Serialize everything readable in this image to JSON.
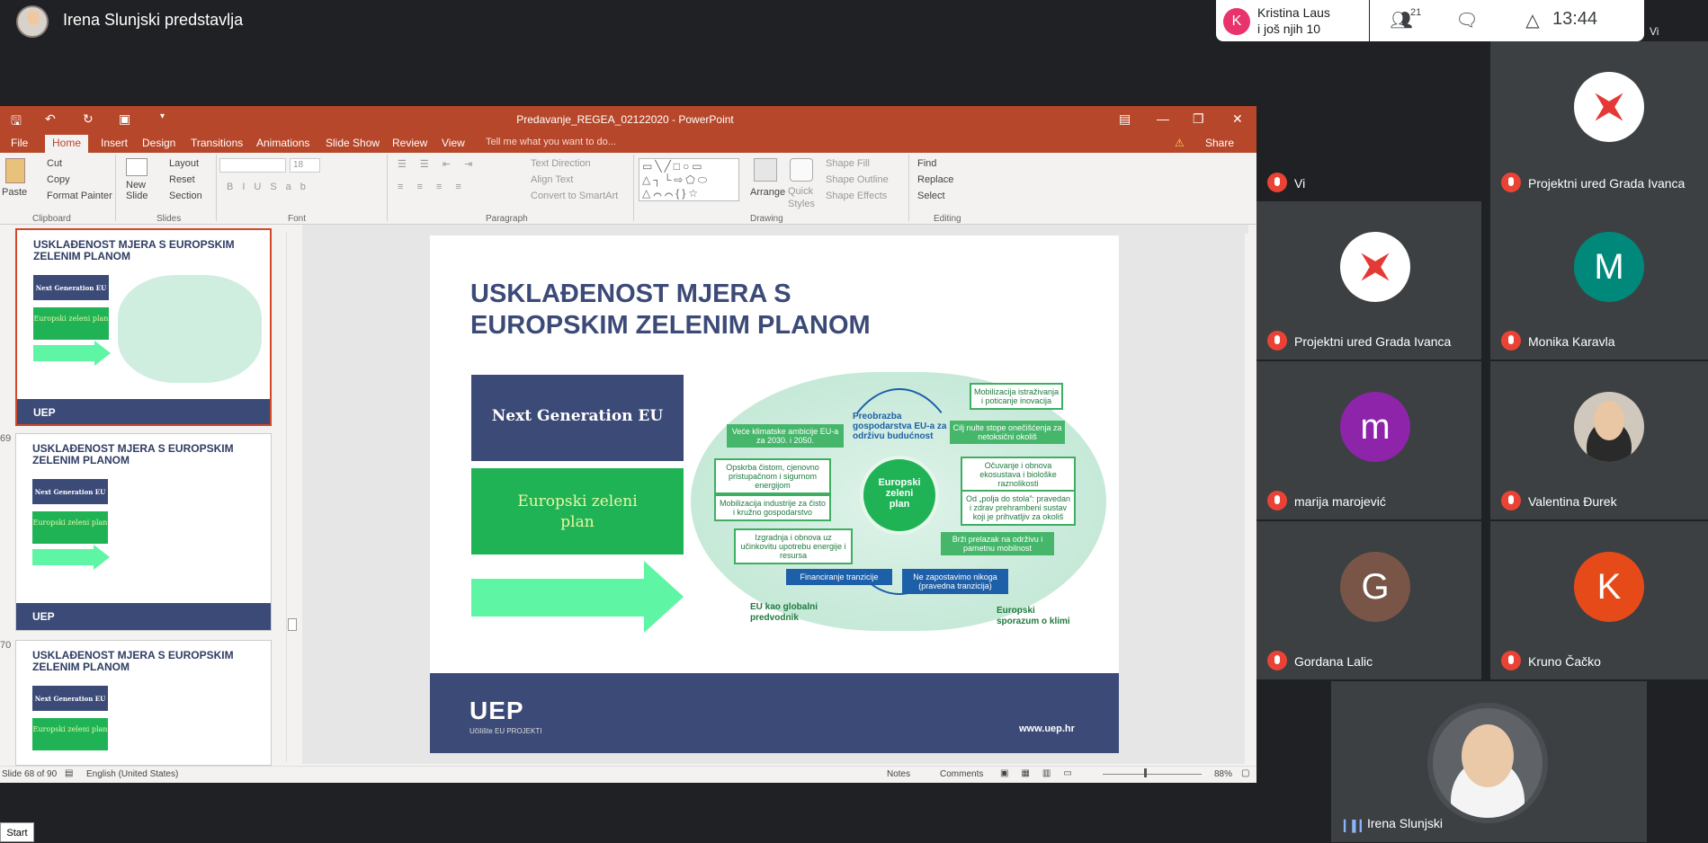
{
  "meet": {
    "presenting_title": "Irena Slunjski predstavlja",
    "notification": {
      "initial": "K",
      "name": "Kristina Laus",
      "more": "i još njih 10"
    },
    "people_count": "21",
    "clock": "13:44",
    "corner_label": "Vi"
  },
  "ppt": {
    "window_title": "Predavanje_REGEA_02122020 - PowerPoint",
    "tabs": [
      "File",
      "Home",
      "Insert",
      "Design",
      "Transitions",
      "Animations",
      "Slide Show",
      "Review",
      "View"
    ],
    "tell_me": "Tell me what you want to do...",
    "share": "Share",
    "ribbon": {
      "paste": "Paste",
      "cut": "Cut",
      "copy": "Copy",
      "format_painter": "Format Painter",
      "clipboard": "Clipboard",
      "new_slide": "New Slide",
      "layout": "Layout",
      "reset": "Reset",
      "section": "Section",
      "slides": "Slides",
      "font_size": "18",
      "font": "Font",
      "text_direction": "Text Direction",
      "align_text": "Align Text",
      "convert_smartart": "Convert to SmartArt",
      "paragraph": "Paragraph",
      "arrange": "Arrange",
      "quick_styles": "Quick Styles",
      "shape_fill": "Shape Fill",
      "shape_outline": "Shape Outline",
      "shape_effects": "Shape Effects",
      "drawing": "Drawing",
      "find": "Find",
      "replace": "Replace",
      "select": "Select",
      "editing": "Editing"
    },
    "thumbnails": [
      {
        "num": "",
        "title": "USKLAĐENOST MJERA S EUROPSKIM ZELENIM PLANOM"
      },
      {
        "num": "69",
        "title": "USKLAĐENOST MJERA S EUROPSKIM ZELENIM PLANOM"
      },
      {
        "num": "70",
        "title": "USKLAĐENOST MJERA S EUROPSKIM ZELENIM PLANOM"
      }
    ],
    "thumb_ng": "Next Generation EU",
    "thumb_ez": "Europski zeleni plan",
    "thumb_logo": "UEP",
    "slide": {
      "title_line1": "USKLAĐENOST MJERA S",
      "title_line2": "EUROPSKIM ZELENIM PLANOM",
      "next_gen": "Next Generation EU",
      "ez_line1": "Europski zeleni",
      "ez_line2": "plan",
      "center_l1": "Europski",
      "center_l2": "zeleni",
      "center_l3": "plan",
      "preobrazba": "Preobrazba gospodarstva EU-a za održivu budućnost",
      "left_boxes": [
        "Veće klimatske ambicije EU-a za 2030. i 2050.",
        "Opskrba čistom, cjenovno pristupačnom i sigurnom energijom",
        "Mobilizacija industrije za čisto i kružno gospodarstvo",
        "Izgradnja i obnova uz učinkovitu upotrebu energije i resursa"
      ],
      "right_boxes": [
        "Mobilizacija istraživanja i poticanje inovacija",
        "Cilj nulte stope onečišćenja za netoksični okoliš",
        "Očuvanje i obnova ekosustava i biološke raznolikosti",
        "Od „polja do stola”: pravedan i zdrav prehrambeni sustav koji je prihvatljiv za okoliš",
        "Brži prelazak na održivu i pametnu mobilnost"
      ],
      "financiranje": "Financiranje tranzicije",
      "ne_zapostavimo": "Ne zapostavimo nikoga (pravedna tranzicija)",
      "eu_global": "EU kao globalni predvodnik",
      "europski_sporazum": "Europski sporazum o klimi",
      "logo": "UEP",
      "logo_sub": "Učilište EU PROJEKTI",
      "url": "www.uep.hr"
    },
    "status": {
      "slide_of": "Slide 68 of 90",
      "language": "English (United States)",
      "notes": "Notes",
      "comments": "Comments",
      "zoom": "88%"
    }
  },
  "participants": [
    {
      "name": "Vi",
      "type": "dark"
    },
    {
      "name": "Projektni ured Grada Ivanca",
      "type": "malta"
    },
    {
      "name": "Projektni ured Grada Ivanca",
      "type": "malta"
    },
    {
      "name": "Monika Karavla",
      "type": "letter",
      "letter": "M",
      "color": "#00897b"
    },
    {
      "name": "marija marojević",
      "type": "letter",
      "letter": "m",
      "color": "#8e24aa"
    },
    {
      "name": "Valentina Đurek",
      "type": "photo"
    },
    {
      "name": "Gordana Lalic",
      "type": "letter",
      "letter": "G",
      "color": "#795548"
    },
    {
      "name": "Kruno Čačko",
      "type": "letter",
      "letter": "K",
      "color": "#e64a19"
    }
  ],
  "self": {
    "name": "Irena Slunjski"
  },
  "taskbar": {
    "start": "Start"
  }
}
